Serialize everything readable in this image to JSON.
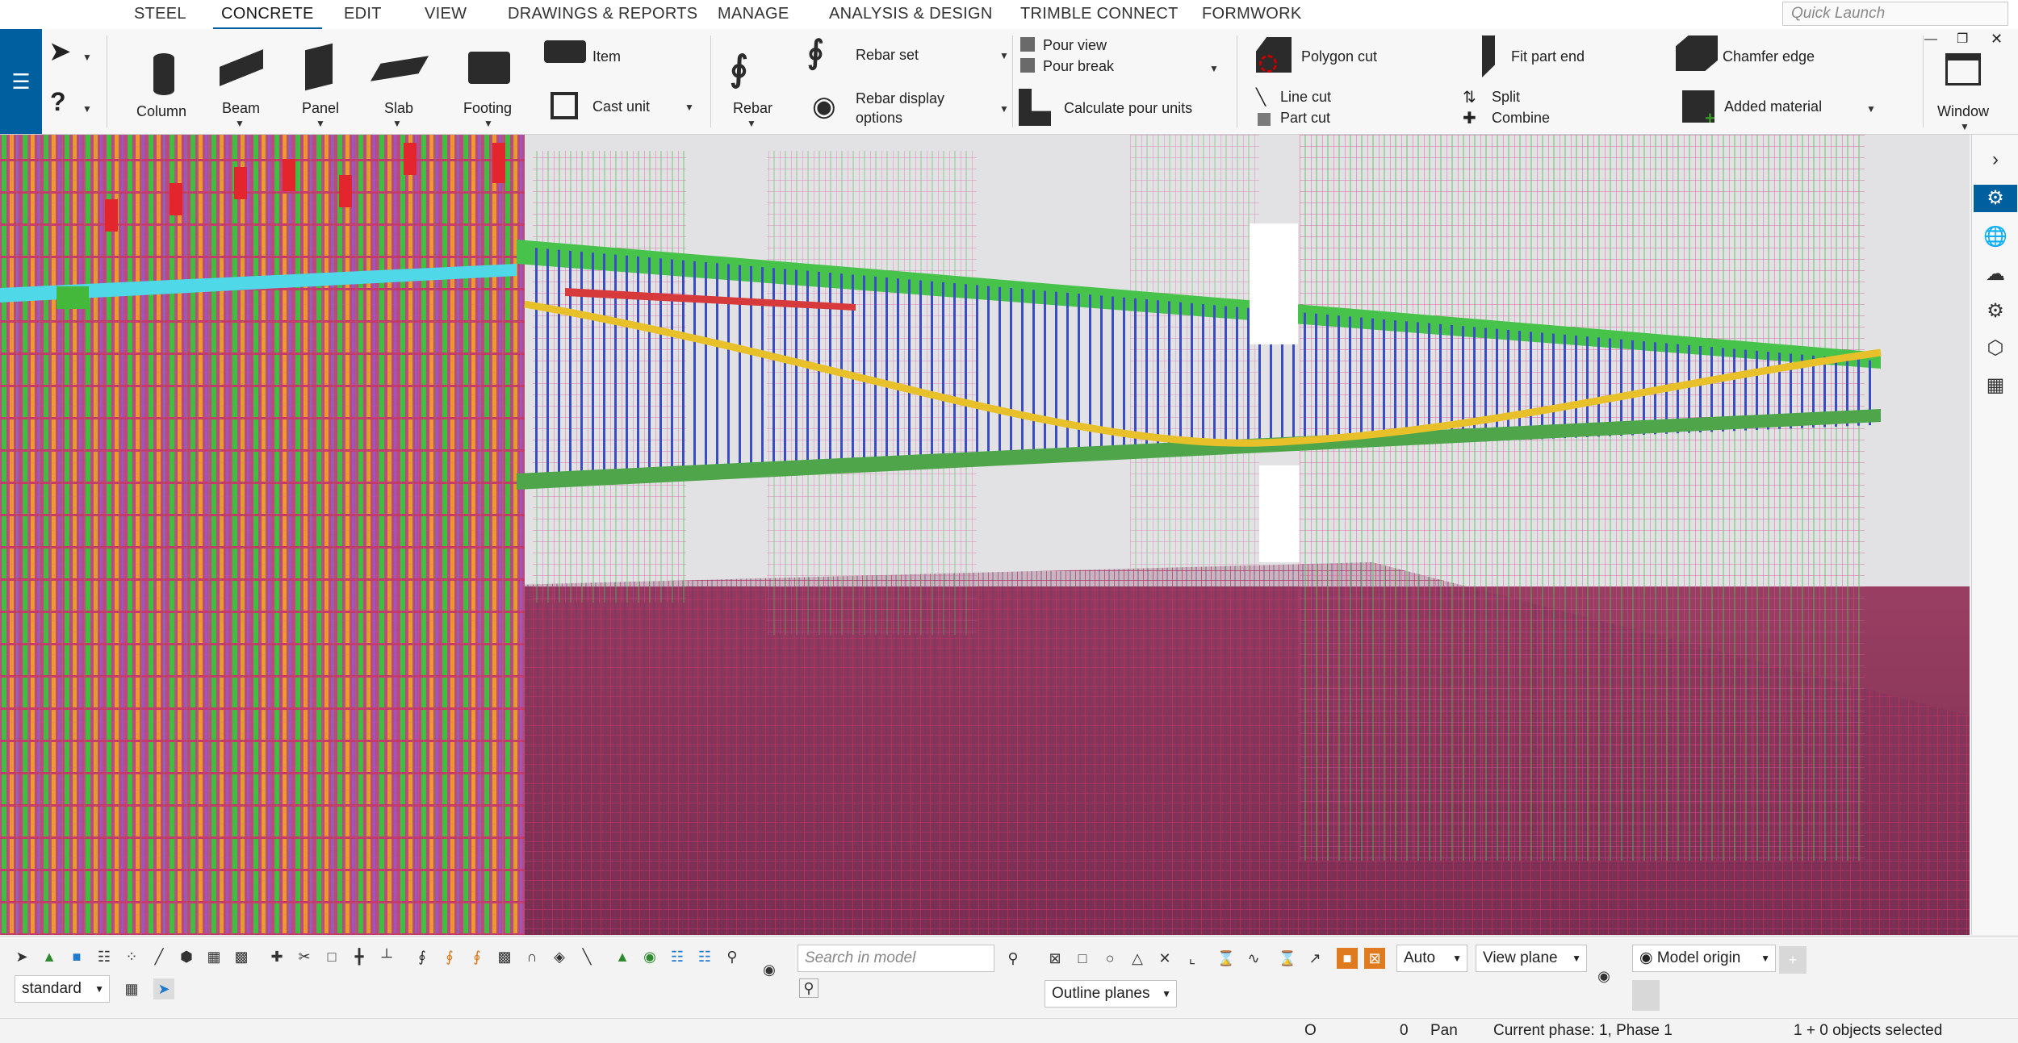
{
  "menu": {
    "tabs": [
      "STEEL",
      "CONCRETE",
      "EDIT",
      "VIEW",
      "DRAWINGS & REPORTS",
      "MANAGE",
      "ANALYSIS & DESIGN",
      "TRIMBLE CONNECT",
      "FORMWORK"
    ],
    "active_tab": "CONCRETE",
    "quick_launch_placeholder": "Quick Launch"
  },
  "ribbon": {
    "column": "Column",
    "beam": "Beam",
    "panel": "Panel",
    "slab": "Slab",
    "footing": "Footing",
    "item": "Item",
    "cast_unit": "Cast unit",
    "rebar": "Rebar",
    "rebar_set": "Rebar set",
    "rebar_display_options_1": "Rebar display",
    "rebar_display_options_2": "options",
    "pour_view": "Pour view",
    "pour_break": "Pour break",
    "calculate_pour_units": "Calculate pour units",
    "polygon_cut": "Polygon cut",
    "line_cut": "Line cut",
    "part_cut": "Part cut",
    "fit_part_end": "Fit part end",
    "split": "Split",
    "combine": "Combine",
    "chamfer_edge": "Chamfer edge",
    "added_material": "Added material",
    "window": "Window"
  },
  "bottom": {
    "standard": "standard",
    "search_placeholder": "Search in model",
    "auto": "Auto",
    "view_plane": "View plane",
    "outline_planes": "Outline planes",
    "model_origin": "Model origin"
  },
  "status": {
    "o": "O",
    "zero": "0",
    "pan": "Pan",
    "phase": "Current phase: 1, Phase 1",
    "selected": "1 + 0 objects selected"
  },
  "colors": {
    "accent": "#005f9e"
  }
}
